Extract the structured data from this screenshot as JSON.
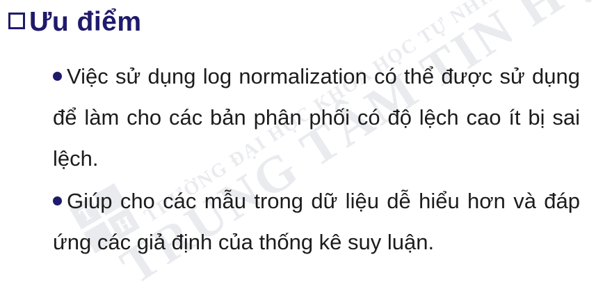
{
  "heading": "Ưu điểm",
  "bullets": [
    "Việc sử dụng log normalization có thể được sử dụng để làm cho các bản phân phối có độ lệch cao ít bị sai lệch.",
    "Giúp cho các mẫu trong dữ liệu dễ hiểu hơn và đáp ứng các giả định của thống kê suy luận."
  ],
  "watermark": {
    "line1": "TRƯỜNG ĐẠI HỌC KHOA HỌC TỰ NHIÊN",
    "line2": "TRUNG TÂM TIN HỌC",
    "logo_letters": [
      "T",
      "H"
    ]
  },
  "colors": {
    "heading": "#1f1a6b",
    "bullet_dot": "#1f1a6b",
    "text": "#1c1c1c",
    "watermark": "#c4c6d0"
  },
  "icons": {
    "heading_marker": "checkbox-square-icon",
    "bullet_marker": "dot-icon",
    "watermark_logo": "center-logo-icon"
  }
}
